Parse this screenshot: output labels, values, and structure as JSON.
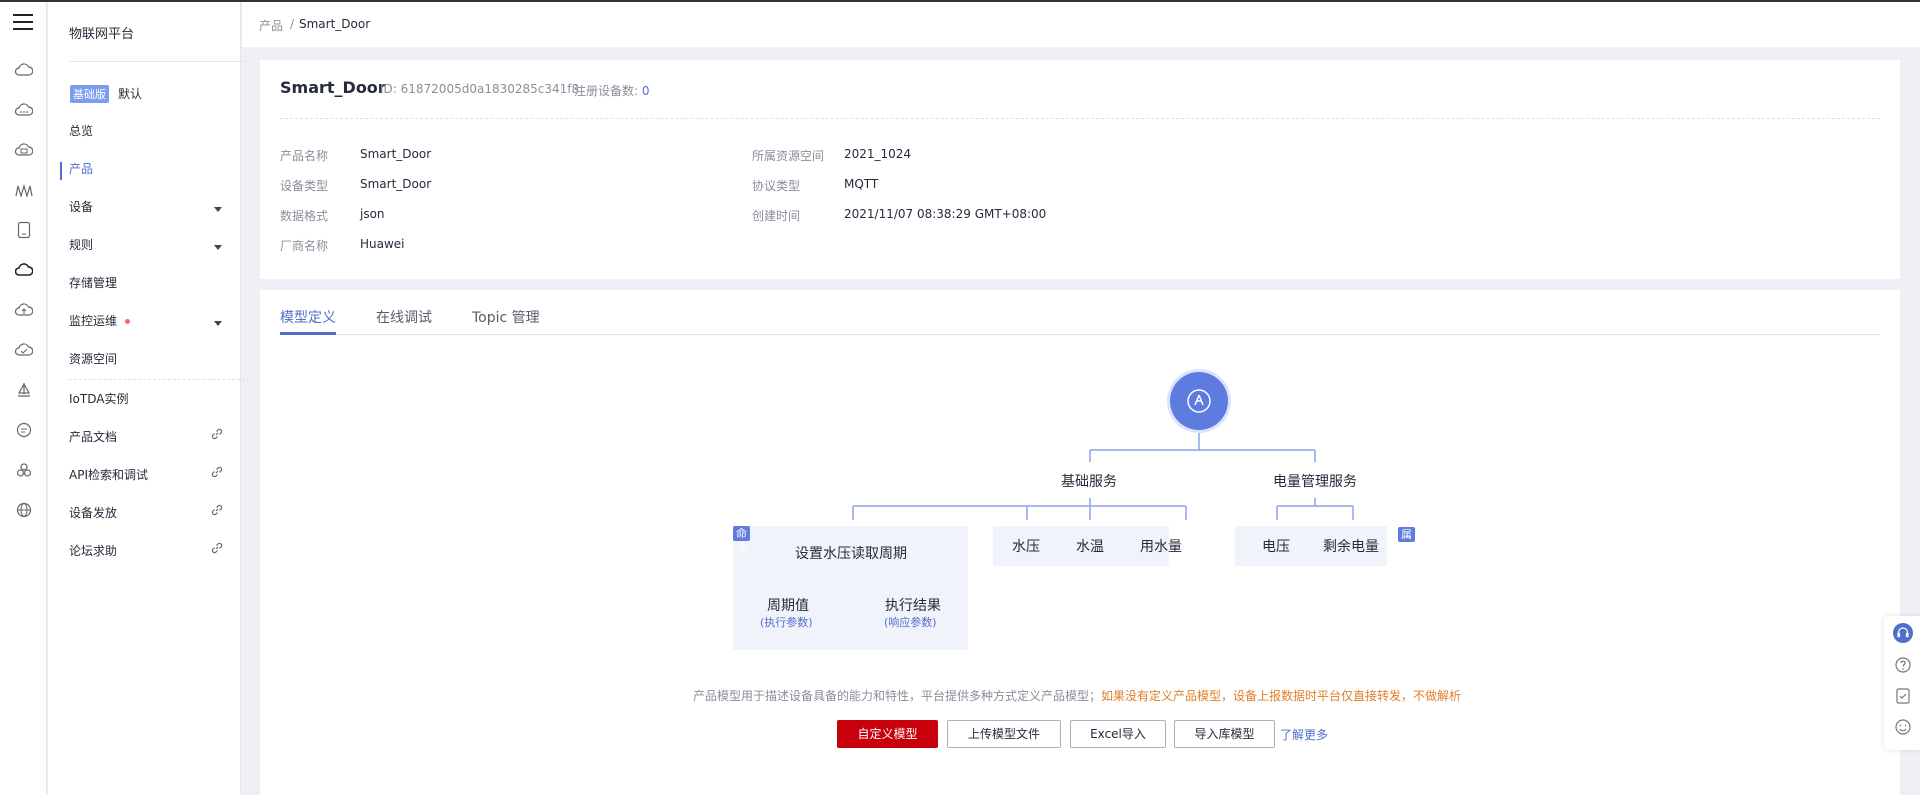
{
  "nav": {
    "title": "物联网平台",
    "edition_badge": "基础版",
    "edition_default": "默认",
    "items": [
      {
        "label": "总览"
      },
      {
        "label": "产品"
      },
      {
        "label": "设备"
      },
      {
        "label": "规则"
      },
      {
        "label": "存储管理"
      },
      {
        "label": "监控运维"
      },
      {
        "label": "资源空间"
      },
      {
        "label": "IoTDA实例"
      },
      {
        "label": "产品文档"
      },
      {
        "label": "API检索和调试"
      },
      {
        "label": "设备发放"
      },
      {
        "label": "论坛求助"
      }
    ]
  },
  "breadcrumb": {
    "parent": "产品",
    "separator": "/",
    "current": "Smart_Door"
  },
  "product": {
    "name": "Smart_Door",
    "id_text": "ID: 61872005d0a1830285c341f8",
    "registered_label": "注册设备数:",
    "registered_count": "0",
    "fields": {
      "name_label": "产品名称",
      "name_value": "Smart_Door",
      "type_label": "设备类型",
      "type_value": "Smart_Door",
      "format_label": "数据格式",
      "format_value": "json",
      "vendor_label": "厂商名称",
      "vendor_value": "Huawei",
      "space_label": "所属资源空间",
      "space_value": "2021_1024",
      "protocol_label": "协议类型",
      "protocol_value": "MQTT",
      "created_label": "创建时间",
      "created_value": "2021/11/07 08:38:29 GMT+08:00"
    }
  },
  "tabs": [
    {
      "label": "模型定义",
      "active": true
    },
    {
      "label": "在线调试",
      "active": false
    },
    {
      "label": "Topic 管理",
      "active": false
    }
  ],
  "diagram": {
    "services": [
      "基础服务",
      "电量管理服务"
    ],
    "command_tag": "命令",
    "property_tag": "属性",
    "command": {
      "name": "设置水压读取周期",
      "param_name": "周期值",
      "param_type": "(执行参数)",
      "result_name": "执行结果",
      "result_type": "(响应参数)"
    },
    "properties": [
      "水压",
      "水温",
      "用水量",
      "电压",
      "剩余电量"
    ]
  },
  "description": {
    "text": "产品模型用于描述设备具备的能力和特性，平台提供多种方式定义产品模型；",
    "warning": "如果没有定义产品模型，设备上报数据时平台仅直接转发，不做解析"
  },
  "buttons": {
    "custom_model": "自定义模型",
    "upload_model": "上传模型文件",
    "excel_import": "Excel导入",
    "import_library": "导入库模型",
    "learn_more": "了解更多"
  },
  "colors": {
    "accent": "#526ecc",
    "primary_button": "#c7000b",
    "warning": "#e37d29",
    "node": "#5e7ce0"
  }
}
